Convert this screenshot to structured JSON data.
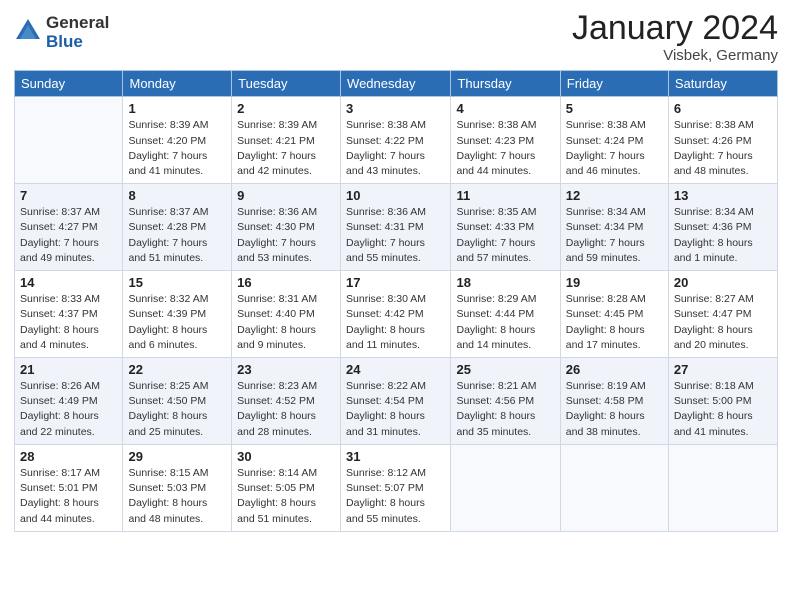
{
  "logo": {
    "general": "General",
    "blue": "Blue"
  },
  "header": {
    "month": "January 2024",
    "location": "Visbek, Germany"
  },
  "columns": [
    "Sunday",
    "Monday",
    "Tuesday",
    "Wednesday",
    "Thursday",
    "Friday",
    "Saturday"
  ],
  "weeks": [
    [
      {
        "day": "",
        "info": ""
      },
      {
        "day": "1",
        "info": "Sunrise: 8:39 AM\nSunset: 4:20 PM\nDaylight: 7 hours\nand 41 minutes."
      },
      {
        "day": "2",
        "info": "Sunrise: 8:39 AM\nSunset: 4:21 PM\nDaylight: 7 hours\nand 42 minutes."
      },
      {
        "day": "3",
        "info": "Sunrise: 8:38 AM\nSunset: 4:22 PM\nDaylight: 7 hours\nand 43 minutes."
      },
      {
        "day": "4",
        "info": "Sunrise: 8:38 AM\nSunset: 4:23 PM\nDaylight: 7 hours\nand 44 minutes."
      },
      {
        "day": "5",
        "info": "Sunrise: 8:38 AM\nSunset: 4:24 PM\nDaylight: 7 hours\nand 46 minutes."
      },
      {
        "day": "6",
        "info": "Sunrise: 8:38 AM\nSunset: 4:26 PM\nDaylight: 7 hours\nand 48 minutes."
      }
    ],
    [
      {
        "day": "7",
        "info": "Sunrise: 8:37 AM\nSunset: 4:27 PM\nDaylight: 7 hours\nand 49 minutes."
      },
      {
        "day": "8",
        "info": "Sunrise: 8:37 AM\nSunset: 4:28 PM\nDaylight: 7 hours\nand 51 minutes."
      },
      {
        "day": "9",
        "info": "Sunrise: 8:36 AM\nSunset: 4:30 PM\nDaylight: 7 hours\nand 53 minutes."
      },
      {
        "day": "10",
        "info": "Sunrise: 8:36 AM\nSunset: 4:31 PM\nDaylight: 7 hours\nand 55 minutes."
      },
      {
        "day": "11",
        "info": "Sunrise: 8:35 AM\nSunset: 4:33 PM\nDaylight: 7 hours\nand 57 minutes."
      },
      {
        "day": "12",
        "info": "Sunrise: 8:34 AM\nSunset: 4:34 PM\nDaylight: 7 hours\nand 59 minutes."
      },
      {
        "day": "13",
        "info": "Sunrise: 8:34 AM\nSunset: 4:36 PM\nDaylight: 8 hours\nand 1 minute."
      }
    ],
    [
      {
        "day": "14",
        "info": "Sunrise: 8:33 AM\nSunset: 4:37 PM\nDaylight: 8 hours\nand 4 minutes."
      },
      {
        "day": "15",
        "info": "Sunrise: 8:32 AM\nSunset: 4:39 PM\nDaylight: 8 hours\nand 6 minutes."
      },
      {
        "day": "16",
        "info": "Sunrise: 8:31 AM\nSunset: 4:40 PM\nDaylight: 8 hours\nand 9 minutes."
      },
      {
        "day": "17",
        "info": "Sunrise: 8:30 AM\nSunset: 4:42 PM\nDaylight: 8 hours\nand 11 minutes."
      },
      {
        "day": "18",
        "info": "Sunrise: 8:29 AM\nSunset: 4:44 PM\nDaylight: 8 hours\nand 14 minutes."
      },
      {
        "day": "19",
        "info": "Sunrise: 8:28 AM\nSunset: 4:45 PM\nDaylight: 8 hours\nand 17 minutes."
      },
      {
        "day": "20",
        "info": "Sunrise: 8:27 AM\nSunset: 4:47 PM\nDaylight: 8 hours\nand 20 minutes."
      }
    ],
    [
      {
        "day": "21",
        "info": "Sunrise: 8:26 AM\nSunset: 4:49 PM\nDaylight: 8 hours\nand 22 minutes."
      },
      {
        "day": "22",
        "info": "Sunrise: 8:25 AM\nSunset: 4:50 PM\nDaylight: 8 hours\nand 25 minutes."
      },
      {
        "day": "23",
        "info": "Sunrise: 8:23 AM\nSunset: 4:52 PM\nDaylight: 8 hours\nand 28 minutes."
      },
      {
        "day": "24",
        "info": "Sunrise: 8:22 AM\nSunset: 4:54 PM\nDaylight: 8 hours\nand 31 minutes."
      },
      {
        "day": "25",
        "info": "Sunrise: 8:21 AM\nSunset: 4:56 PM\nDaylight: 8 hours\nand 35 minutes."
      },
      {
        "day": "26",
        "info": "Sunrise: 8:19 AM\nSunset: 4:58 PM\nDaylight: 8 hours\nand 38 minutes."
      },
      {
        "day": "27",
        "info": "Sunrise: 8:18 AM\nSunset: 5:00 PM\nDaylight: 8 hours\nand 41 minutes."
      }
    ],
    [
      {
        "day": "28",
        "info": "Sunrise: 8:17 AM\nSunset: 5:01 PM\nDaylight: 8 hours\nand 44 minutes."
      },
      {
        "day": "29",
        "info": "Sunrise: 8:15 AM\nSunset: 5:03 PM\nDaylight: 8 hours\nand 48 minutes."
      },
      {
        "day": "30",
        "info": "Sunrise: 8:14 AM\nSunset: 5:05 PM\nDaylight: 8 hours\nand 51 minutes."
      },
      {
        "day": "31",
        "info": "Sunrise: 8:12 AM\nSunset: 5:07 PM\nDaylight: 8 hours\nand 55 minutes."
      },
      {
        "day": "",
        "info": ""
      },
      {
        "day": "",
        "info": ""
      },
      {
        "day": "",
        "info": ""
      }
    ]
  ]
}
